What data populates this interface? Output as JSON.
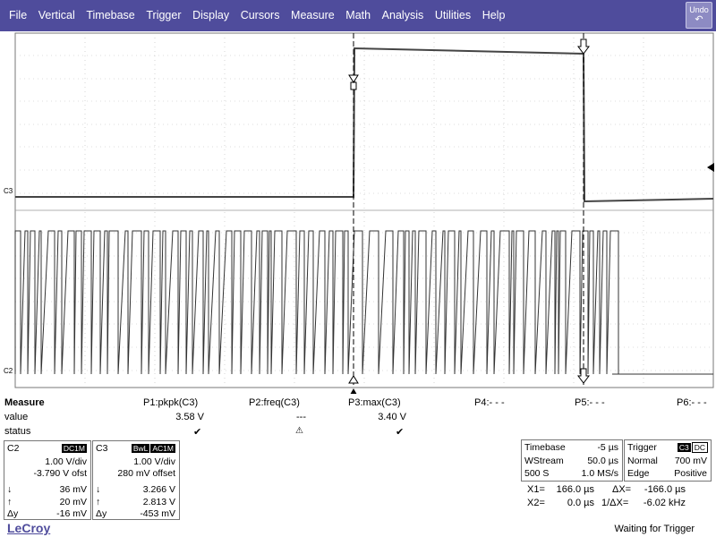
{
  "menu": {
    "items": [
      "File",
      "Vertical",
      "Timebase",
      "Trigger",
      "Display",
      "Cursors",
      "Measure",
      "Math",
      "Analysis",
      "Utilities",
      "Help"
    ],
    "undo_label": "Undo",
    "undo_icon": "undo-arrow-icon"
  },
  "grid": {
    "ch3_label": "C3",
    "ch2_label": "C2"
  },
  "measure": {
    "title": "Measure",
    "row_value_label": "value",
    "row_status_label": "status",
    "params": [
      {
        "name": "P1:pkpk(C3)",
        "value": "3.58 V",
        "status": "check-icon"
      },
      {
        "name": "P2:freq(C3)",
        "value": "---",
        "status": "warning-icon"
      },
      {
        "name": "P3:max(C3)",
        "value": "3.40 V",
        "status": "check-icon"
      },
      {
        "name": "P4:- - -",
        "value": "",
        "status": ""
      },
      {
        "name": "P5:- - -",
        "value": "",
        "status": ""
      },
      {
        "name": "P6:- - -",
        "value": "",
        "status": ""
      }
    ]
  },
  "c2": {
    "name": "C2",
    "coupling": "DC1M",
    "vdiv": "1.00 V/div",
    "offset": "-3.790 V ofst",
    "down_val": "36 mV",
    "up_val": "20 mV",
    "dy_label": "Δy",
    "dy_val": "-16 mV"
  },
  "c3": {
    "name": "C3",
    "bwl": "BwL",
    "coupling": "AC1M",
    "vdiv": "1.00 V/div",
    "offset": "280 mV offset",
    "down_val": "3.266 V",
    "up_val": "2.813 V",
    "dy_label": "Δy",
    "dy_val": "-453 mV"
  },
  "timebase": {
    "label": "Timebase",
    "delay": "-5 µs",
    "mode": "WStream",
    "tdiv": "50.0 µs",
    "samples": "500 S",
    "rate": "1.0 MS/s"
  },
  "trigger": {
    "label": "Trigger",
    "src": "C3",
    "coupling": "DC",
    "mode": "Normal",
    "level": "700 mV",
    "type": "Edge",
    "slope": "Positive"
  },
  "cursors": {
    "x1_label": "X1=",
    "x1_val": "166.0 µs",
    "dx_label": "ΔX=",
    "dx_val": "-166.0 µs",
    "x2_label": "X2=",
    "x2_val": "0.0 µs",
    "inv_label": "1/ΔX=",
    "inv_val": "-6.02 kHz"
  },
  "brand": "LeCroy",
  "status": "Waiting for Trigger",
  "colors": {
    "menubar": "#4f4c9c",
    "undo": "#8d8bc3",
    "brand": "#4f4c9c"
  }
}
